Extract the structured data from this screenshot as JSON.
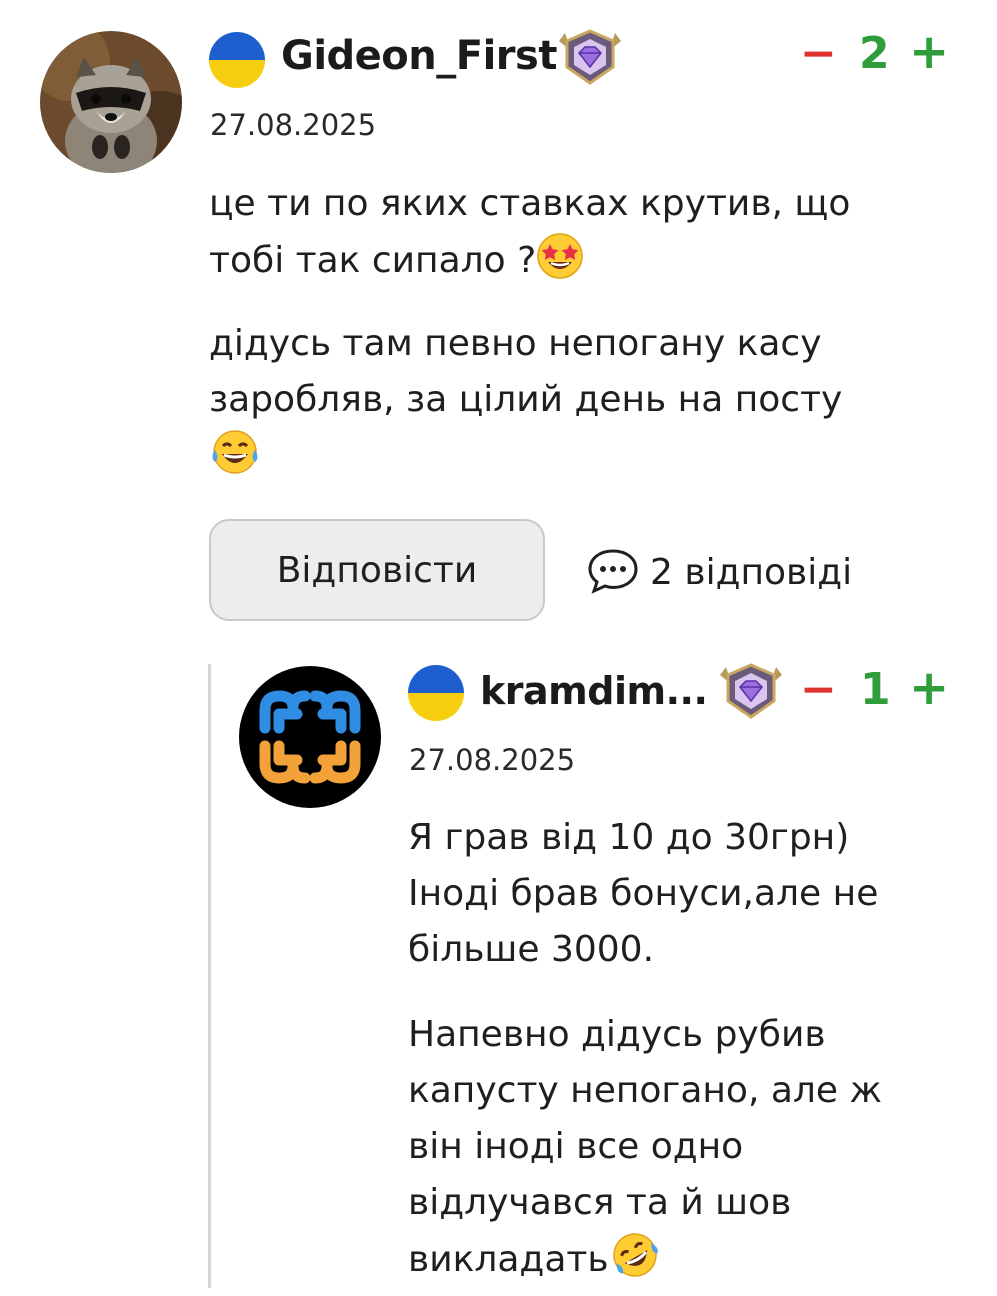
{
  "comments": [
    {
      "username": "Gideon_First",
      "date": "27.08.2025",
      "votes": {
        "minus": "−",
        "count": "2",
        "plus": "+"
      },
      "paragraphs": [
        {
          "line1": "це ти по яких ставках крутив, що",
          "line2": "тобі так сипало ?"
        },
        {
          "line1": "дідусь там певно непогану касу",
          "line2": "заробляв, за цілий день на посту"
        }
      ],
      "emojis": [
        "star-struck-emoji",
        "face-with-tears-of-joy-emoji"
      ]
    }
  ],
  "actions": {
    "reply_label": "Відповісти",
    "replies_label": "2 відповіді"
  },
  "reply": {
    "username": "kramdim...",
    "date": "27.08.2025",
    "votes": {
      "minus": "−",
      "count": "1",
      "plus": "+"
    },
    "paragraph1": [
      "Я грав від 10 до 30грн)",
      "Іноді брав бонуси,але не",
      "більше 3000."
    ],
    "paragraph2": [
      "Напевно дідусь рубив",
      "капусту непогано, але ж",
      "він іноді все одно",
      "відлучався та й шов",
      "викладать"
    ],
    "emojis": [
      "rolling-on-floor-laughing-emoji"
    ]
  },
  "colors": {
    "minus": "#e0332e",
    "plus": "#2f9e3a",
    "flag_blue": "#1e5fd0",
    "flag_yellow": "#f6cd0f",
    "button_bg": "#ededed"
  }
}
